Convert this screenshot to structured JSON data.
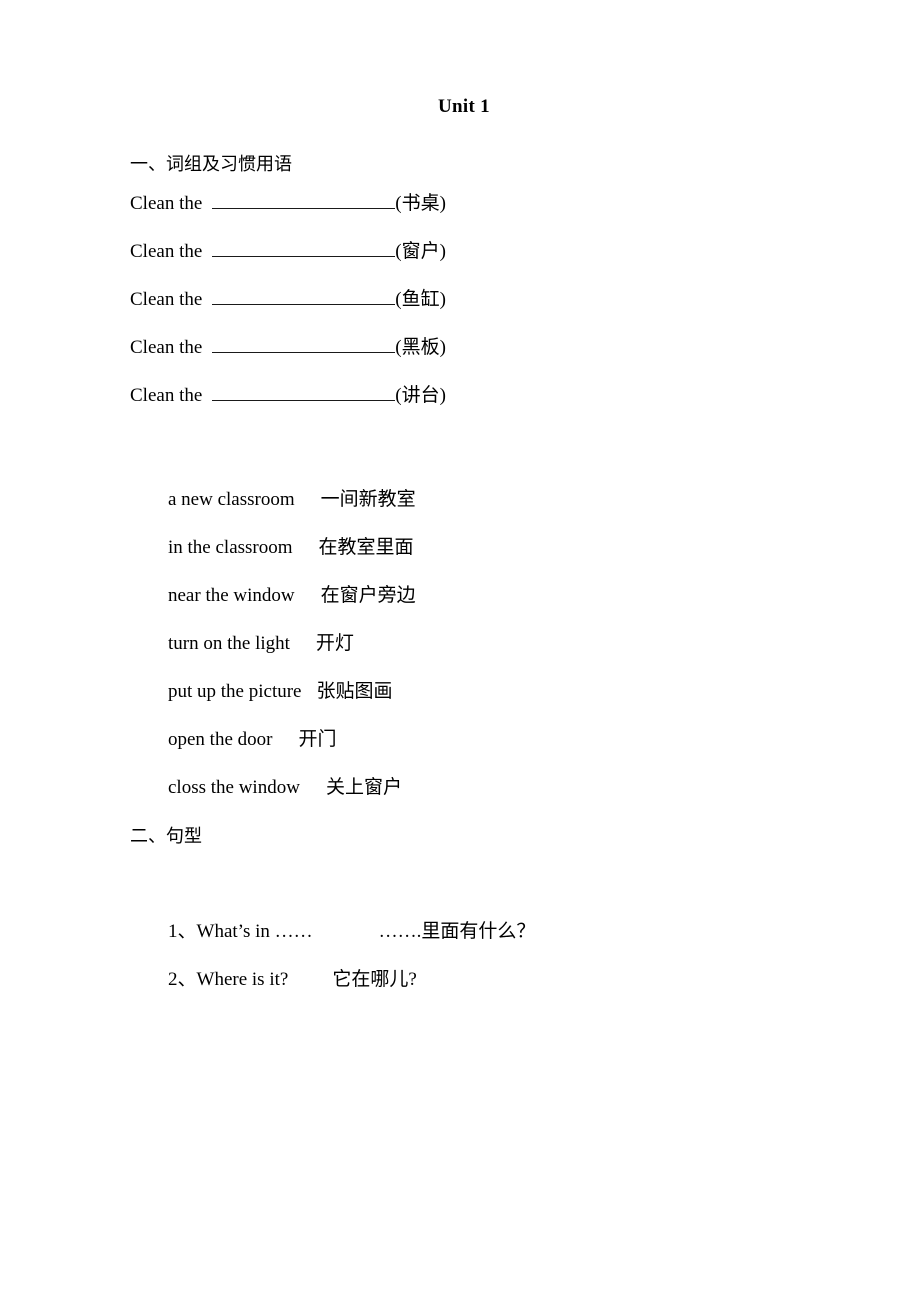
{
  "document": {
    "title": "Unit 1"
  },
  "sections": [
    {
      "heading": "一、词组及习惯用语",
      "blank_exercises": [
        {
          "prompt": "Clean the",
          "answer_hint": "(书桌)"
        },
        {
          "prompt": "Clean the",
          "answer_hint": "(窗户)"
        },
        {
          "prompt": "Clean the",
          "answer_hint": "(鱼缸)"
        },
        {
          "prompt": "Clean the",
          "answer_hint": "(黑板)"
        },
        {
          "prompt": "Clean the",
          "answer_hint": "(讲台)"
        }
      ],
      "phrases": [
        {
          "english": "a new classroom",
          "chinese": "一间新教室",
          "gap": 26
        },
        {
          "english": "in the classroom",
          "chinese": "在教室里面",
          "gap": 26
        },
        {
          "english": "near the window",
          "chinese": "在窗户旁边",
          "gap": 26
        },
        {
          "english": "turn on the light",
          "chinese": "开灯",
          "gap": 26
        },
        {
          "english": "put up the picture",
          "chinese": "张贴图画",
          "gap": 15
        },
        {
          "english": "open the door",
          "chinese": "开门",
          "gap": 26
        },
        {
          "english": "closs the window",
          "chinese": "关上窗户",
          "gap": 26
        }
      ]
    },
    {
      "heading": "二、句型",
      "patterns": [
        {
          "number": "1、",
          "english": "What’s in ……",
          "chinese": "…….里面有什么？",
          "gap": 66
        },
        {
          "number": "2、",
          "english": "Where is it?",
          "chinese": "它在哪儿?",
          "gap": 44
        }
      ]
    }
  ]
}
